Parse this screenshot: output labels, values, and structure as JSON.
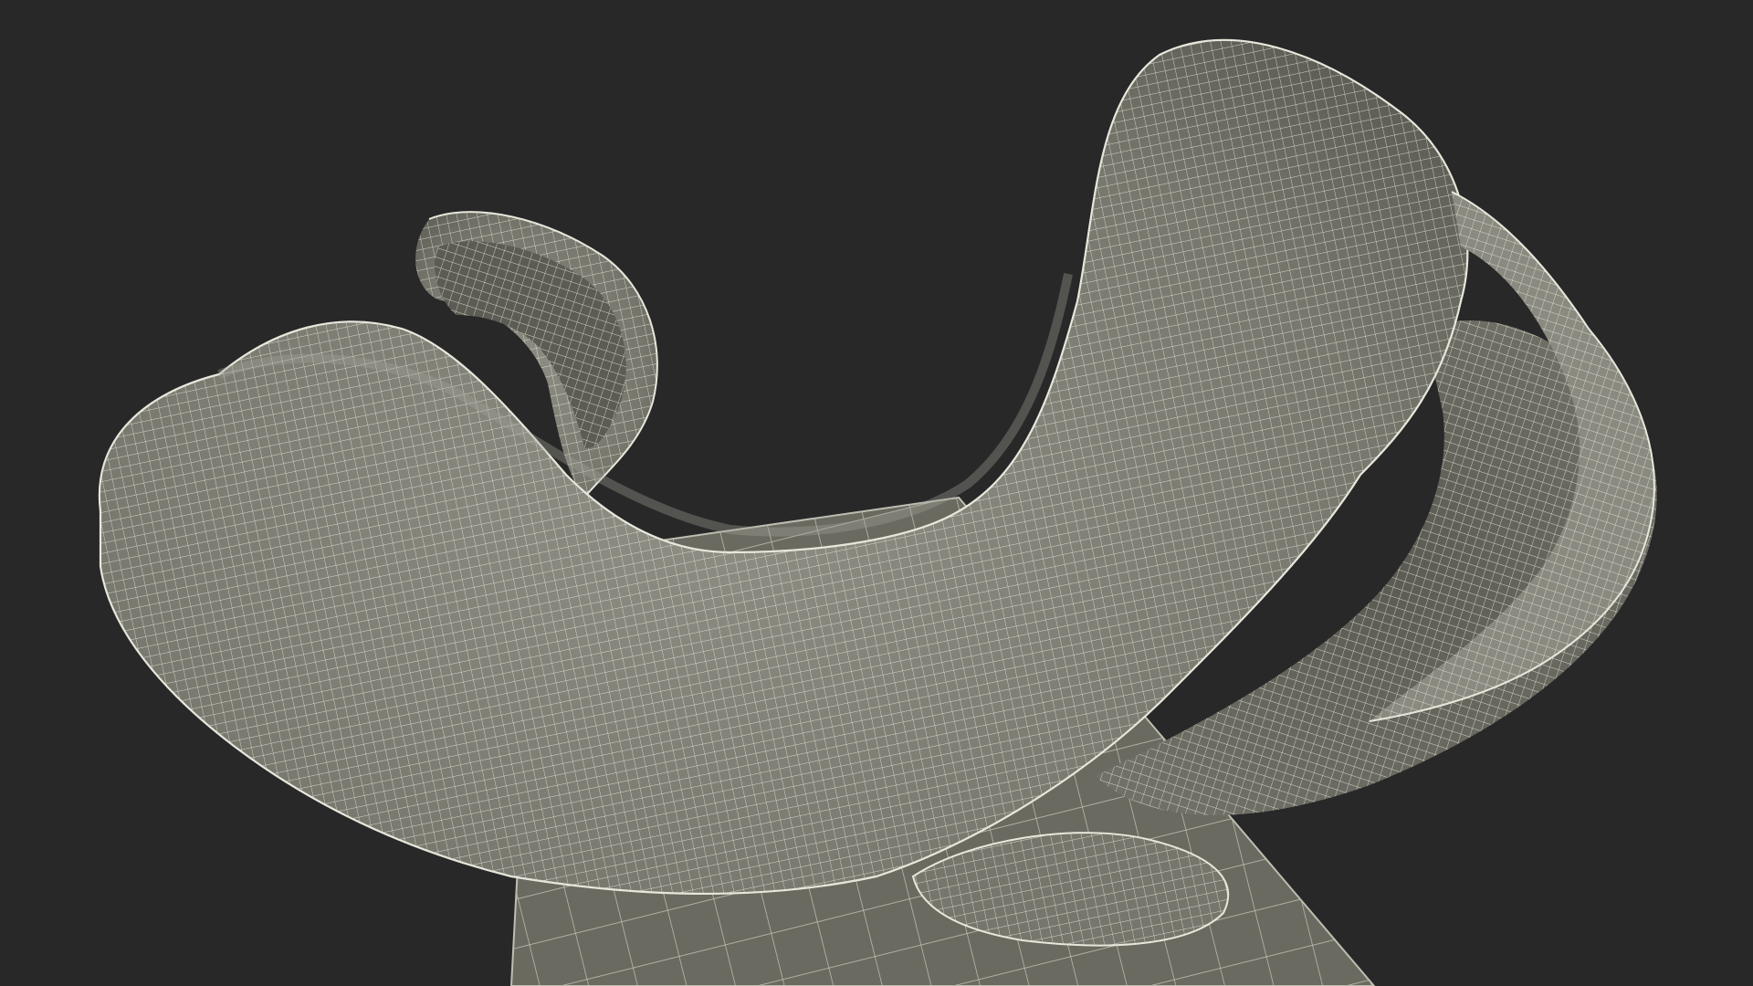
{
  "scene": {
    "subject": "organ-wireframe-render",
    "colors": {
      "background": "#282828",
      "mesh_fill": "#7c7c72",
      "mesh_fill_light": "#9a9a8f",
      "mesh_fill_dark": "#55554e",
      "wire": "#e7e7dc",
      "plate_fill": "#6a6a60",
      "plate_wire": "#cfcfc3"
    },
    "show_wireframe": true,
    "show_ground_plate": true
  }
}
